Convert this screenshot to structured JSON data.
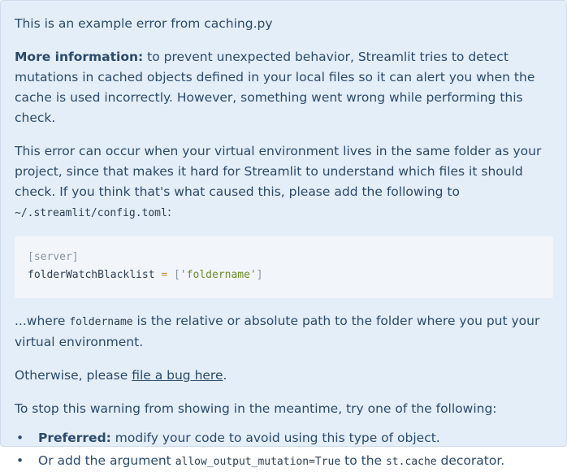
{
  "alert": {
    "intro": "This is an example error from caching.py",
    "more_info": {
      "label": "More information:",
      "text": " to prevent unexpected behavior, Streamlit tries to detect mutations in cached objects defined in your local files so it can alert you when the cache is used incorrectly. However, something went wrong while performing this check."
    },
    "cause": {
      "text": "This error can occur when your virtual environment lives in the same folder as your project, since that makes it hard for Streamlit to understand which files it should check. If you think that's what caused this, please add the following to ",
      "path": "~/.streamlit/config.toml",
      "suffix": ":"
    },
    "code": {
      "line1_open": "[",
      "line1_key": "server",
      "line1_close": "]",
      "line2_key": "folderWatchBlacklist ",
      "line2_op": "=",
      "line2_space": " ",
      "line2_open": "[",
      "line2_value": "'foldername'",
      "line2_close": "]"
    },
    "where": {
      "prefix": "...where ",
      "code": "foldername",
      "text": " is the relative or absolute path to the folder where you put your virtual environment."
    },
    "otherwise": {
      "prefix": "Otherwise, please ",
      "link": "file a bug here",
      "suffix": "."
    },
    "stop": "To stop this warning from showing in the meantime, try one of the following:",
    "options": {
      "bullet": "•",
      "preferred_label": "Preferred:",
      "preferred_text": " modify your code to avoid using this type of object.",
      "second_prefix": "Or add the argument ",
      "second_code": "allow_output_mutation=True",
      "second_mid": " to the ",
      "second_code2": "st.cache",
      "second_suffix": " decorator."
    }
  },
  "colors": {
    "background": "#e4eef8",
    "text": "#2b4a6a",
    "code_background": "#f2f6fb"
  }
}
